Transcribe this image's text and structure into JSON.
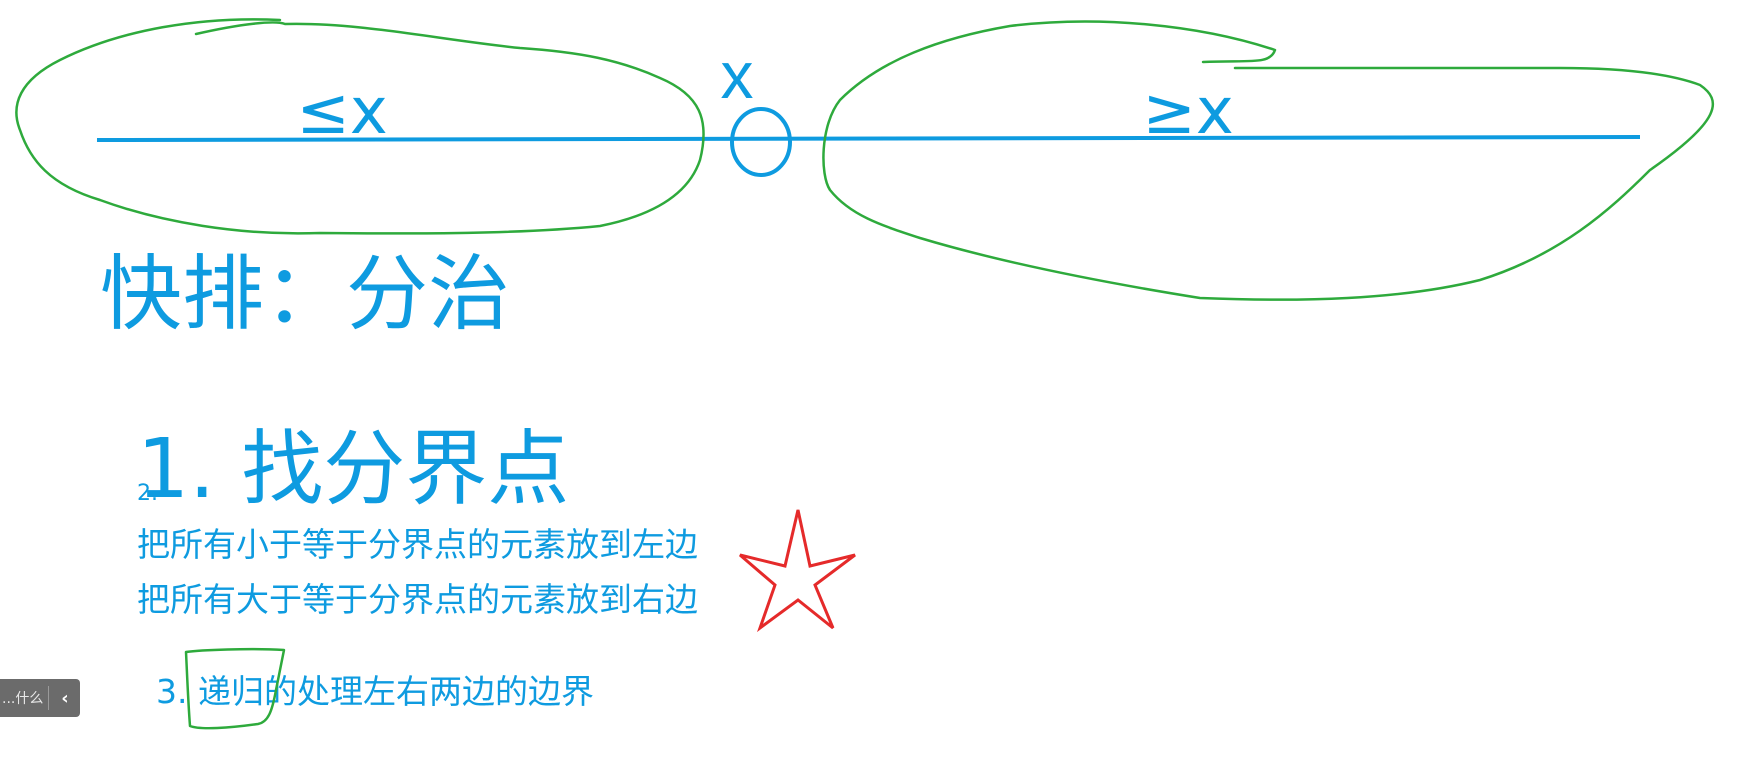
{
  "texts": {
    "pivot_label": "x",
    "left_label": "≤x",
    "right_label": "≥x",
    "heading": "快排：分治",
    "step1": "1. 找分界点",
    "step2_marker": "2.",
    "line_left": "把所有小于等于分界点的元素放到左边",
    "line_right": "把所有大于等于分界点的元素放到右边",
    "step3": "3. 递归的处理左右两边的边界"
  },
  "widget": {
    "text": "什么...",
    "collapse_icon": "chevron-left-icon"
  },
  "colors": {
    "blue": "#0e9be0",
    "green": "#2eaa3c",
    "red": "#e52a2a",
    "widget_bg": "#6b6b6b"
  }
}
